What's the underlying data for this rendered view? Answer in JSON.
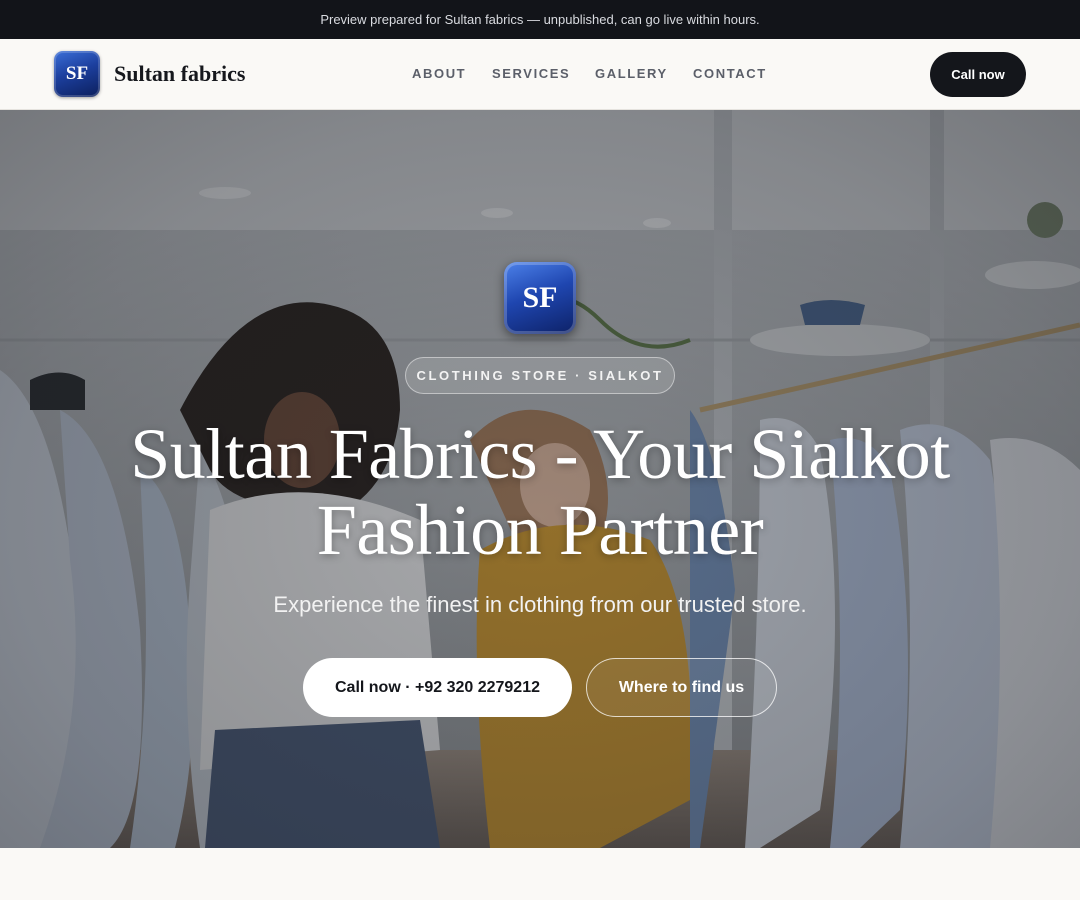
{
  "preview_banner": {
    "text": "Preview prepared for Sultan fabrics — unpublished, can go live within hours."
  },
  "header": {
    "logo_text": "SF",
    "brand_name": "Sultan fabrics",
    "nav": [
      {
        "label": "ABOUT"
      },
      {
        "label": "SERVICES"
      },
      {
        "label": "GALLERY"
      },
      {
        "label": "CONTACT"
      }
    ],
    "call_button": "Call now"
  },
  "hero": {
    "logo_text": "SF",
    "tagline": "CLOTHING STORE · SIALKOT",
    "title": "Sultan Fabrics - Your Sialkot Fashion Partner",
    "subtitle": "Experience the finest in clothing from our trusted store.",
    "primary_button": "Call now · +92 320 2279212",
    "secondary_button": "Where to find us"
  },
  "colors": {
    "top_bar": "#121419",
    "header_bg": "#faf9f6",
    "dark_button": "#14161b",
    "logo_blue": "#1c3f9e"
  }
}
